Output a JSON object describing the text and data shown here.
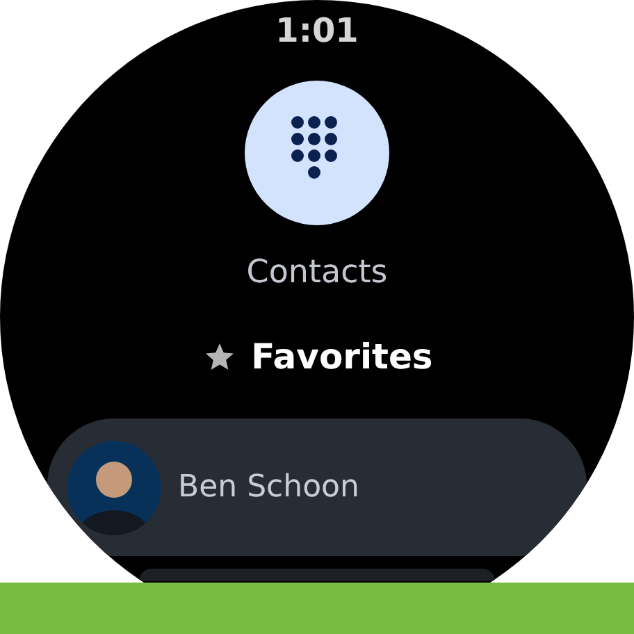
{
  "status_bar": {
    "time": "1:01"
  },
  "dialpad_button": {
    "label": "Contacts"
  },
  "section": {
    "title": "Favorites"
  },
  "contacts": [
    {
      "name": "Ben Schoon"
    }
  ]
}
